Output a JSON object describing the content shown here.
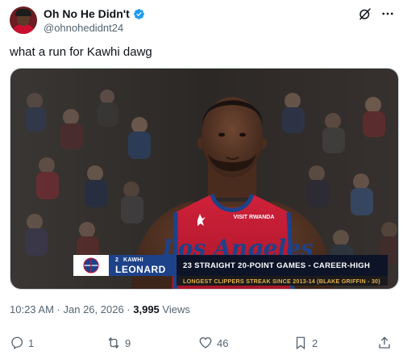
{
  "author": {
    "display_name": "Oh No He Didn't",
    "handle": "@ohnohedidnt24"
  },
  "tweet": {
    "text": "what a run for Kawhi dawg"
  },
  "media": {
    "jersey_sponsor": "VISIT RWANDA",
    "jersey_script": "Los Angeles",
    "lower_third": {
      "number": "2",
      "first_name": "KAWHI",
      "last_name": "LEONARD",
      "stat": "23 STRAIGHT 20-POINT GAMES - CAREER-HIGH",
      "subline": "LONGEST CLIPPERS STREAK SINCE 2013-14 (BLAKE GRIFFIN - 30)"
    }
  },
  "meta": {
    "time": "10:23 AM",
    "separator": " · ",
    "date": "Jan 26, 2026",
    "views_count": "3,995",
    "views_label": "Views"
  },
  "actions": {
    "replies": "1",
    "reposts": "9",
    "likes": "46",
    "bookmarks": "2"
  },
  "colors": {
    "accent_blue": "#1d9bf0",
    "clippers_red": "#c8102e",
    "clippers_navy": "#1d428a",
    "streak_gold": "#e6b04a"
  }
}
